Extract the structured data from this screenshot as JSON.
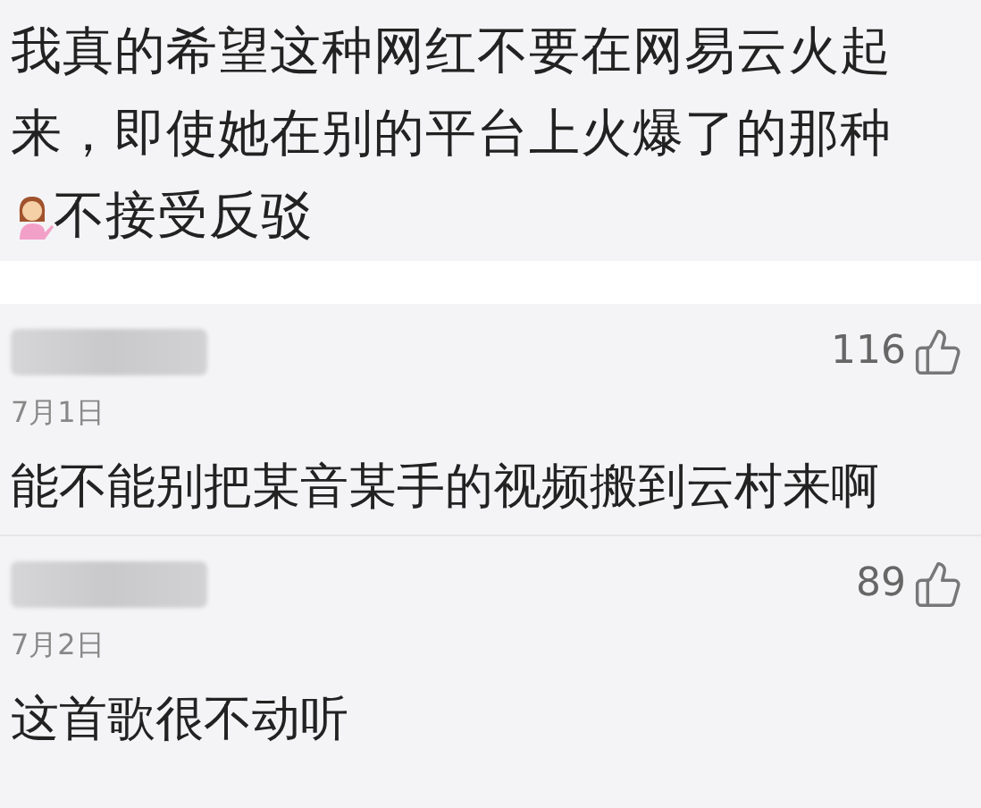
{
  "post": {
    "segments": [
      {
        "kind": "text",
        "text": "我真的希望这种网红不要在网易云火起来，即使她在别的平台上火爆了的那种"
      },
      {
        "kind": "emoji"
      },
      {
        "kind": "text",
        "text": "不接受反驳"
      }
    ]
  },
  "comments": [
    {
      "likes": "116",
      "date": "7月1日",
      "text": "能不能别把某音某手的视频搬到云村来啊"
    },
    {
      "likes": "89",
      "date": "7月2日",
      "text": "这首歌很不动听"
    }
  ]
}
